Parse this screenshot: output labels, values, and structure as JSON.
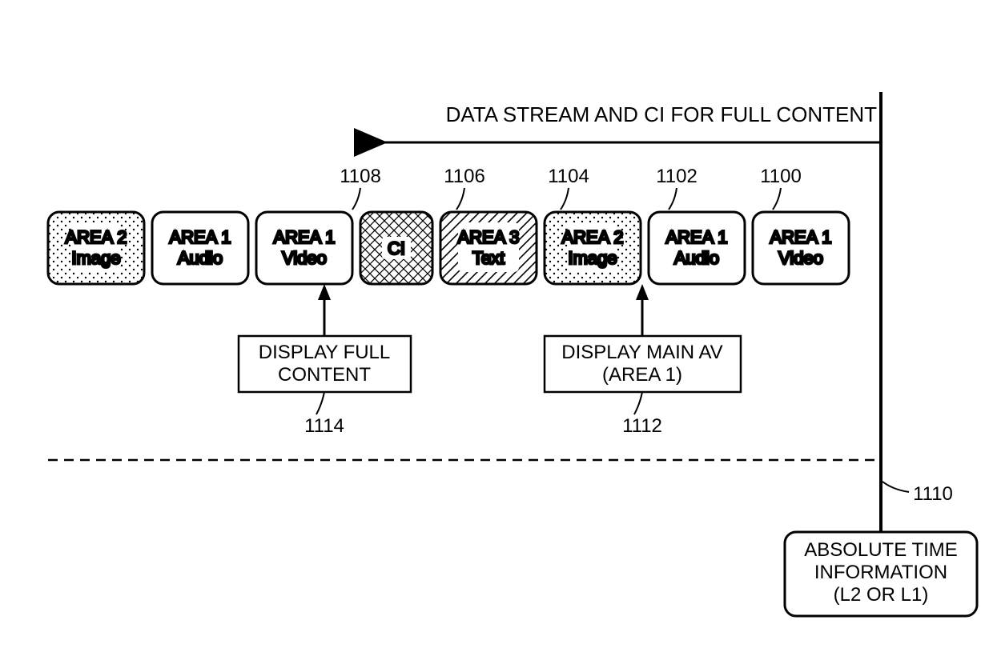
{
  "arrowLabel": "DATA STREAM AND CI FOR FULL CONTENT",
  "blocks": [
    {
      "line1": "AREA 2",
      "line2": "Image"
    },
    {
      "line1": "AREA 1",
      "line2": "Audio"
    },
    {
      "line1": "AREA 1",
      "line2": "Video"
    },
    {
      "line1": "CI",
      "line2": ""
    },
    {
      "line1": "AREA 3",
      "line2": "Text"
    },
    {
      "line1": "AREA 2",
      "line2": "Image"
    },
    {
      "line1": "AREA 1",
      "line2": "Audio"
    },
    {
      "line1": "AREA 1",
      "line2": "Video"
    }
  ],
  "refs": {
    "r1108": "1108",
    "r1106": "1106",
    "r1104": "1104",
    "r1102": "1102",
    "r1100": "1100",
    "r1114": "1114",
    "r1112": "1112",
    "r1110": "1110"
  },
  "displayFull": {
    "line1": "DISPLAY FULL",
    "line2": "CONTENT"
  },
  "displayMain": {
    "line1": "DISPLAY MAIN AV",
    "line2": "(AREA 1)"
  },
  "absTime": {
    "line1": "ABSOLUTE TIME",
    "line2": "INFORMATION",
    "line3": "(L2 OR L1)"
  }
}
